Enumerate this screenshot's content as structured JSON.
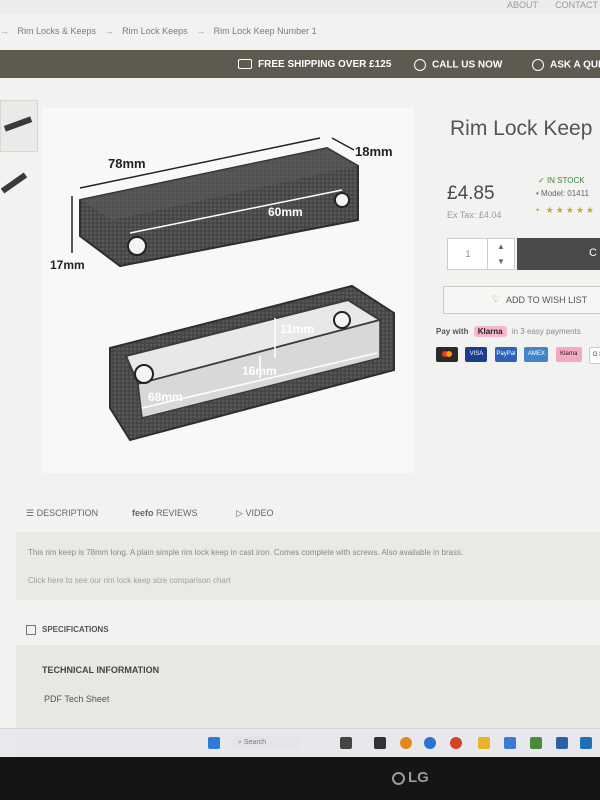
{
  "header": {
    "about": "ABOUT",
    "contact": "CONTACT"
  },
  "breadcrumb": [
    "Rim Locks & Keeps",
    "Rim Lock Keeps",
    "Rim Lock Keep Number 1"
  ],
  "infobar": {
    "shipping": "FREE SHIPPING OVER £125",
    "call": "CALL US NOW",
    "ask": "ASK A QUE"
  },
  "product": {
    "title": "Rim Lock Keep N",
    "price": "£4.85",
    "ex_tax": "Ex Tax: £4.04",
    "stock": "IN STOCK",
    "model": "Model: 01411",
    "stars": "★★★★★",
    "quantity": "1",
    "wishlist": "ADD TO WISH LIST",
    "klarna_pay_with": "Pay with",
    "klarna_brand": "Klarna",
    "klarna_text": "in 3 easy payments",
    "payment_methods": [
      {
        "name": "mastercard",
        "label": "",
        "color": "#2a2a2a"
      },
      {
        "name": "visa",
        "label": "VISA",
        "color": "#1a3d8f"
      },
      {
        "name": "paypal",
        "label": "PayPal",
        "color": "#2c63b7"
      },
      {
        "name": "amex",
        "label": "AMEX",
        "color": "#3f86c8"
      },
      {
        "name": "klarna",
        "label": "Klarna",
        "color": "#f2a9c2"
      },
      {
        "name": "gpay",
        "label": "G Pay",
        "color": "#ffffff"
      }
    ],
    "add_to_cart": "C"
  },
  "image_labels": {
    "length_top": "78mm",
    "depth": "18mm",
    "height": "17mm",
    "inner_top": "60mm",
    "inner_depth": "11mm",
    "inner_width": "16mm",
    "inner_length": "68mm"
  },
  "tabs": {
    "description": "DESCRIPTION",
    "feefo": "feefo",
    "reviews": "REVIEWS",
    "video": "VIDEO"
  },
  "description": {
    "text": "This rim keep is 78mm long. A plain simple rim lock keep in cast iron. Comes complete with screws. Also available in brass.",
    "link": "Click here to see our rim lock keep size comparison chart"
  },
  "specifications": {
    "heading": "SPECIFICATIONS",
    "technical": "TECHNICAL INFORMATION",
    "pdf": "PDF Tech Sheet"
  },
  "taskbar": {
    "search": "Search"
  },
  "monitor": {
    "brand": "LG"
  }
}
